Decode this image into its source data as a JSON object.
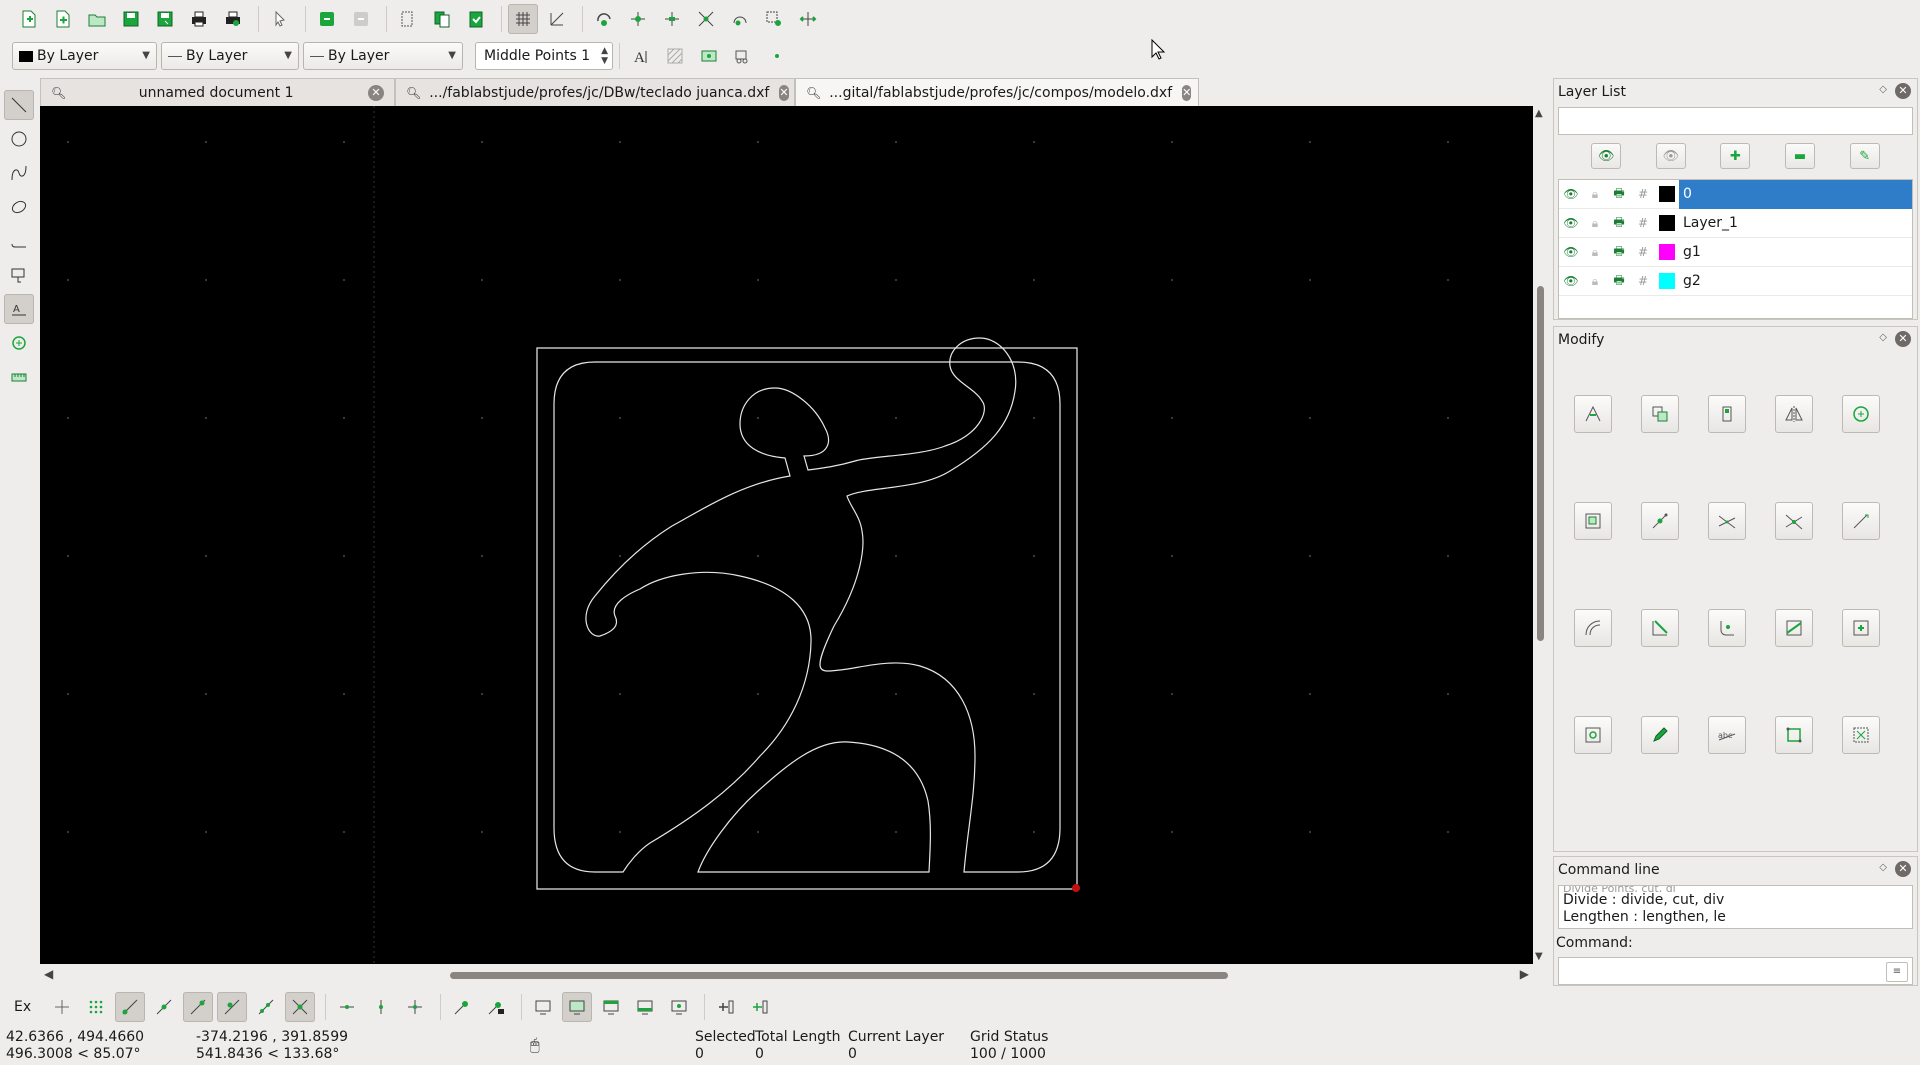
{
  "toolbar": {
    "colors": {
      "accent": "#1aa63c",
      "pressed": "#d3d0cc"
    }
  },
  "pen": {
    "color": "By Layer",
    "linetype": "By Layer",
    "width": "By Layer",
    "snap_middle": "Middle Points 1"
  },
  "tabs": [
    {
      "label": "unnamed document 1",
      "active": false
    },
    {
      "label": ".../fablabstjude/profes/jc/DBw/teclado juanca.dxf",
      "active": false
    },
    {
      "label": "...gital/fablabstjude/profes/jc/compos/modelo.dxf",
      "active": true
    }
  ],
  "layer_list": {
    "title": "Layer List",
    "filter_value": "",
    "layers": [
      {
        "name": "0",
        "color": "#000000",
        "selected": true
      },
      {
        "name": "Layer_1",
        "color": "#000000",
        "selected": false
      },
      {
        "name": "g1",
        "color": "#ff00ff",
        "selected": false
      },
      {
        "name": "g2",
        "color": "#00ffff",
        "selected": false
      }
    ]
  },
  "modify": {
    "title": "Modify"
  },
  "command_line": {
    "title": "Command line",
    "history_clipped": "Divide Points, cut, di",
    "history": [
      "Divide : divide, cut, div",
      "Lengthen : lengthen, le"
    ],
    "label": "Command:",
    "input_value": ""
  },
  "snap_toolbar": {
    "ex_label": "Ex"
  },
  "status": {
    "abs_coord": "42.6366 , 494.4660",
    "abs_polar": "496.3008 < 85.07°",
    "rel_coord": "-374.2196 , 391.8599",
    "rel_polar": "541.8436 < 133.68°",
    "selected_label": "Selected",
    "selected_value": "0",
    "total_length_label": "Total Length",
    "total_length_value": "0",
    "current_layer_label": "Current Layer",
    "current_layer_value": "0",
    "grid_status_label": "Grid Status",
    "grid_status_value": "100 / 1000"
  }
}
